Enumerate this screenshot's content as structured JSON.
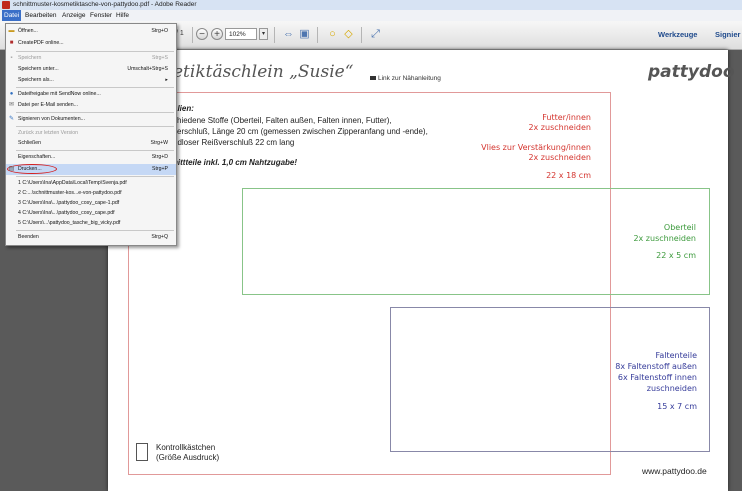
{
  "window": {
    "title": "schnittmuster-kosmetiktasche-von-pattydoo.pdf - Adobe Reader"
  },
  "menubar": {
    "items": [
      "Datei",
      "Bearbeiten",
      "Anzeige",
      "Fenster",
      "Hilfe"
    ]
  },
  "toolbar": {
    "page_suffix": "/ 1",
    "zoom": "102%",
    "tools_label": "Werkzeuge",
    "sign_label": "Signier"
  },
  "file_menu": {
    "items": [
      {
        "label": "Öffnen...",
        "shortcut": "Strg+O",
        "icon": "folder-icon",
        "disabled": false
      },
      {
        "label": "CreatePDF online...",
        "shortcut": "",
        "icon": "pdf-icon",
        "disabled": false
      },
      {
        "label": "Speichern",
        "shortcut": "Strg+S",
        "icon": "save-icon",
        "disabled": true
      },
      {
        "label": "Speichern unter...",
        "shortcut": "Umschalt+Strg+S",
        "icon": "",
        "disabled": false
      },
      {
        "label": "Speichern als...",
        "shortcut": "",
        "icon": "",
        "disabled": false,
        "submenu": true
      },
      {
        "label": "Dateifreigabe mit SendNow online...",
        "shortcut": "",
        "icon": "share-icon",
        "disabled": false
      },
      {
        "label": "Datei per E-Mail senden...",
        "shortcut": "",
        "icon": "mail-icon",
        "disabled": false
      },
      {
        "label": "Signieren von Dokumenten...",
        "shortcut": "",
        "icon": "sign-icon",
        "disabled": false
      },
      {
        "label": "Zurück zur letzten Version",
        "shortcut": "",
        "icon": "",
        "disabled": true
      },
      {
        "label": "Schließen",
        "shortcut": "Strg+W",
        "icon": "",
        "disabled": false
      },
      {
        "label": "Eigenschaften...",
        "shortcut": "Strg+D",
        "icon": "",
        "disabled": false
      },
      {
        "label": "Drucken...",
        "shortcut": "Strg+P",
        "icon": "printer-icon",
        "disabled": false,
        "highlighted": true
      },
      {
        "label": "1 C:\\Users\\Ina\\AppData\\Local\\Temp\\Svenja.pdf",
        "shortcut": "",
        "icon": "",
        "disabled": false
      },
      {
        "label": "2 C:...\\schnittmuster-kos...e-von-pattydoo.pdf",
        "shortcut": "",
        "icon": "",
        "disabled": false
      },
      {
        "label": "3 C:\\Users\\Ina\\...\\pattydoo_cosy_cape-1.pdf",
        "shortcut": "",
        "icon": "",
        "disabled": false
      },
      {
        "label": "4 C:\\Users\\Ina\\...\\pattydoo_cosy_cape.pdf",
        "shortcut": "",
        "icon": "",
        "disabled": false
      },
      {
        "label": "5 C:\\Users\\...\\pattydoo_tasche_big_vicky.pdf",
        "shortcut": "",
        "icon": "",
        "disabled": false
      },
      {
        "label": "Beenden",
        "shortcut": "Strg+Q",
        "icon": "",
        "disabled": false
      }
    ]
  },
  "document": {
    "title": "etiktäschlein „Susie“",
    "link_label": "Link zur Nähanleitung",
    "logo": "pattydoo",
    "materials": [
      "alien:",
      "chiedene Stoffe (Oberteil, Falten außen, Falten innen, Futter),",
      "verschluß, Länge 20 cm (gemessen zwischen Zipperanfang und -ende),",
      "ndloser Reißverschluß 22 cm lang",
      "nittteile inkl. 1,0 cm Nahtzugabe!"
    ],
    "piece_red": [
      "Futter/innen",
      "2x zuschneiden",
      "Vlies zur Verstärkung/innen",
      "2x zuschneiden",
      "22 x 18 cm"
    ],
    "piece_green": [
      "Oberteil",
      "2x zuschneiden",
      "22 x 5 cm"
    ],
    "piece_blue": [
      "Faltenteile",
      "8x Faltenstoff außen",
      "6x Faltenstoff innen",
      "zuschneiden",
      "15 x 7 cm"
    ],
    "control": [
      "Kontrollkästchen",
      "(Größe Ausdruck)"
    ],
    "website": "www.pattydoo.de"
  }
}
